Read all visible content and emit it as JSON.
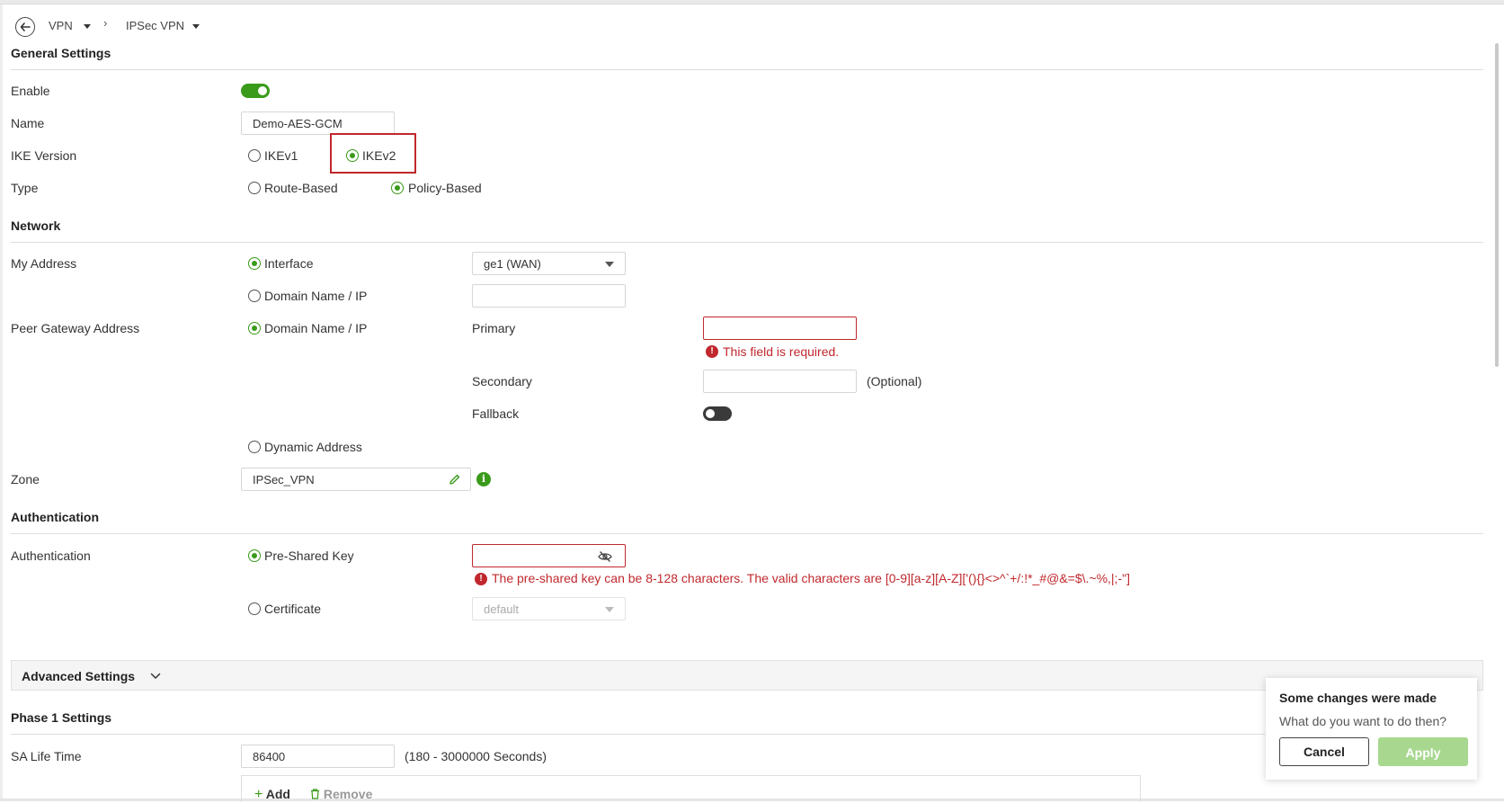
{
  "breadcrumb": {
    "vpn": "VPN",
    "ipsec": "IPSec VPN"
  },
  "general": {
    "title": "General Settings",
    "enable_label": "Enable",
    "name_label": "Name",
    "name_value": "Demo-AES-GCM",
    "ike_label": "IKE Version",
    "ike_v1": "IKEv1",
    "ike_v2": "IKEv2",
    "type_label": "Type",
    "type_route": "Route-Based",
    "type_policy": "Policy-Based"
  },
  "network": {
    "title": "Network",
    "my_address_label": "My Address",
    "interface_label": "Interface",
    "interface_value": "ge1 (WAN)",
    "domain_ip_label": "Domain Name / IP",
    "peer_label": "Peer Gateway Address",
    "peer_domain_label": "Domain Name / IP",
    "primary_label": "Primary",
    "primary_error": "This field is required.",
    "secondary_label": "Secondary",
    "optional_text": "(Optional)",
    "fallback_label": "Fallback",
    "dynamic_label": "Dynamic Address",
    "zone_label": "Zone",
    "zone_value": "IPSec_VPN"
  },
  "auth": {
    "title": "Authentication",
    "auth_label": "Authentication",
    "psk_label": "Pre-Shared Key",
    "psk_error": "The pre-shared key can be 8-128 characters. The valid characters are [0-9][a-z][A-Z]['(){}<>^`+/:!*_#@&=$\\.~%,|;-\"]",
    "cert_label": "Certificate",
    "cert_value": "default"
  },
  "advanced": {
    "title": "Advanced Settings"
  },
  "phase1": {
    "title": "Phase 1 Settings",
    "sa_label": "SA Life Time",
    "sa_value": "86400",
    "sa_hint": "(180 - 3000000 Seconds)",
    "add_label": "Add",
    "remove_label": "Remove"
  },
  "popup": {
    "title": "Some changes were made",
    "message": "What do you want to do then?",
    "cancel": "Cancel",
    "apply": "Apply"
  },
  "colors": {
    "accent_green": "#3a9a1a",
    "error_red": "#c0282d",
    "apply_disabled": "#a8d890"
  }
}
